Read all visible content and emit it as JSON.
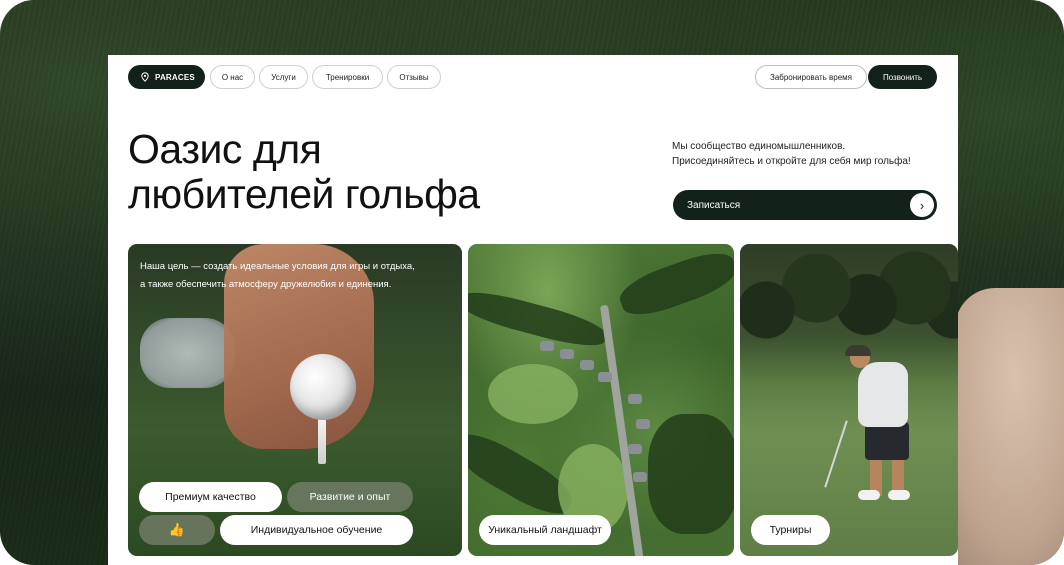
{
  "header": {
    "logo_text": "PARACES",
    "nav": [
      "О нас",
      "Услуги",
      "Тренировки",
      "Отзывы"
    ],
    "cta_outline": "Забронировать время",
    "cta_dark": "Позвонить"
  },
  "hero": {
    "title_line_1": "Оазис для",
    "title_line_2": "любителей гольфа",
    "desc_line_1": "Мы сообщество единомышленников.",
    "desc_line_2": "Присоединяйтесь и откройте для себя мир гольфа!",
    "signup_label": "Записаться",
    "signup_arrow": "›"
  },
  "cards": {
    "card1": {
      "text_line_1": "Наша цель — создать идеальные условия для игры и отдыха,",
      "text_line_2": "а также обеспечить атмосферу дружелюбия и единения.",
      "chips": [
        "Премиум качество",
        "Развитие и опыт",
        "Индивидуальное обучение"
      ],
      "like_icon": "👍"
    },
    "card2": {
      "chip": "Уникальный ландшафт"
    },
    "card3": {
      "chip": "Турниры"
    }
  },
  "colors": {
    "brand_dark": "#12221a",
    "background_green": "#1d2d19"
  }
}
